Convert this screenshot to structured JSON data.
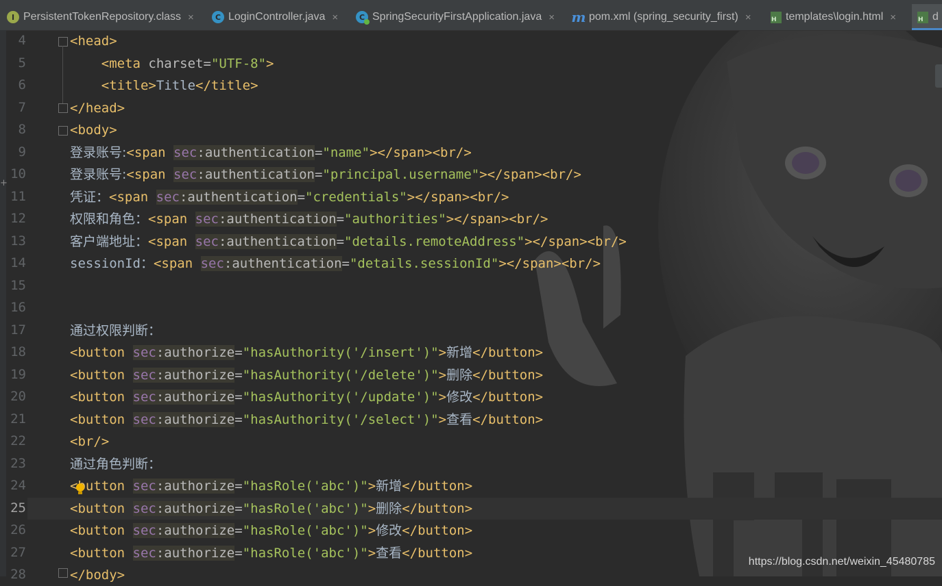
{
  "tabs": [
    {
      "label": "PersistentTokenRepository.class",
      "icon": "interface-icon",
      "icon_glyph": "I",
      "closable": true
    },
    {
      "label": "LoginController.java",
      "icon": "class-icon",
      "icon_glyph": "C",
      "closable": true
    },
    {
      "label": "SpringSecurityFirstApplication.java",
      "icon": "spring-app-icon",
      "icon_glyph": "C",
      "closable": true
    },
    {
      "label": "pom.xml (spring_security_first)",
      "icon": "maven-icon",
      "icon_glyph": "m",
      "closable": true
    },
    {
      "label": "templates\\login.html",
      "icon": "html-file-icon",
      "icon_glyph": "",
      "closable": true
    },
    {
      "label": "d",
      "icon": "html-file-icon",
      "icon_glyph": "",
      "closable": false,
      "active": true
    }
  ],
  "tab_close_glyph": "×",
  "line_numbers": [
    "4",
    "5",
    "6",
    "7",
    "8",
    "9",
    "10",
    "11",
    "12",
    "13",
    "14",
    "15",
    "16",
    "17",
    "18",
    "19",
    "20",
    "21",
    "22",
    "23",
    "24",
    "25",
    "26",
    "27",
    "28"
  ],
  "current_line": "25",
  "code": {
    "l4": {
      "lt": "<",
      "tag": "head",
      "gt": ">"
    },
    "l5": {
      "indent": "    ",
      "lt": "<",
      "tag": "meta",
      "attr": " charset",
      "eq": "=",
      "val": "\"UTF-8\"",
      "gt": ">"
    },
    "l6": {
      "indent": "    ",
      "open": "<title>",
      "text": "Title",
      "close": "</title>"
    },
    "l7": {
      "tag": "</head>"
    },
    "l8": {
      "tag": "<body>"
    },
    "l9": {
      "prefix": "登录账号:",
      "open": "<span ",
      "ns": "sec",
      "attr": ":authentication",
      "eq": "=",
      "val": "\"name\"",
      "close": "></span><br/>"
    },
    "l10": {
      "prefix": "登录账号:",
      "open": "<span ",
      "ns": "sec",
      "attr": ":authentication",
      "eq": "=",
      "val": "\"principal.username\"",
      "close": "></span><br/>"
    },
    "l11": {
      "prefix": "凭证：",
      "open": "<span ",
      "ns": "sec",
      "attr": ":authentication",
      "eq": "=",
      "val": "\"credentials\"",
      "close": "></span><br/>"
    },
    "l12": {
      "prefix": "权限和角色：",
      "open": "<span ",
      "ns": "sec",
      "attr": ":authentication",
      "eq": "=",
      "val": "\"authorities\"",
      "close": "></span><br/>"
    },
    "l13": {
      "prefix": "客户端地址：",
      "open": "<span ",
      "ns": "sec",
      "attr": ":authentication",
      "eq": "=",
      "val": "\"details.remoteAddress\"",
      "close": "></span><br/>"
    },
    "l14": {
      "prefix": "sessionId：",
      "open": "<span ",
      "ns": "sec",
      "attr": ":authentication",
      "eq": "=",
      "val": "\"details.sessionId\"",
      "close": "></span><br/>"
    },
    "l17": {
      "text": "通过权限判断："
    },
    "l18": {
      "open": "<button ",
      "ns": "sec",
      "attr": ":authorize",
      "eq": "=",
      "val": "\"hasAuthority('/insert')\"",
      "gt": ">",
      "label": "新增",
      "close": "</button>"
    },
    "l19": {
      "open": "<button ",
      "ns": "sec",
      "attr": ":authorize",
      "eq": "=",
      "val": "\"hasAuthority('/delete')\"",
      "gt": ">",
      "label": "删除",
      "close": "</button>"
    },
    "l20": {
      "open": "<button ",
      "ns": "sec",
      "attr": ":authorize",
      "eq": "=",
      "val": "\"hasAuthority('/update')\"",
      "gt": ">",
      "label": "修改",
      "close": "</button>"
    },
    "l21": {
      "open": "<button ",
      "ns": "sec",
      "attr": ":authorize",
      "eq": "=",
      "val": "\"hasAuthority('/select')\"",
      "gt": ">",
      "label": "查看",
      "close": "</button>"
    },
    "l22": {
      "tag": "<br/>"
    },
    "l23": {
      "text": "通过角色判断："
    },
    "l24": {
      "open": "<button ",
      "ns": "sec",
      "attr": ":authorize",
      "eq": "=",
      "val": "\"hasRole('abc')\"",
      "gt": ">",
      "label": "新增",
      "close": "</button>"
    },
    "l25": {
      "open": "<button ",
      "ns": "sec",
      "attr": ":authorize",
      "eq": "=",
      "val": "\"hasRole('abc')\"",
      "gt": ">",
      "label": "删除",
      "close": "</button>"
    },
    "l26": {
      "open": "<button ",
      "ns": "sec",
      "attr": ":authorize",
      "eq": "=",
      "val": "\"hasRole('abc')\"",
      "gt": ">",
      "label": "修改",
      "close": "</button>"
    },
    "l27": {
      "open": "<button ",
      "ns": "sec",
      "attr": ":authorize",
      "eq": "=",
      "val": "\"hasRole('abc')\"",
      "gt": ">",
      "label": "查看",
      "close": "</button>"
    },
    "l28": {
      "tag": "</body>"
    }
  },
  "watermark": "https://blog.csdn.net/weixin_45480785",
  "colors": {
    "editor_bg": "#2b2b2b",
    "tag": "#e8bf6a",
    "attr": "#bababa",
    "value": "#a5c25c",
    "namespace": "#9876aa",
    "text": "#a9b7c6",
    "line_number": "#606366",
    "current_line_bg": "#323232"
  }
}
